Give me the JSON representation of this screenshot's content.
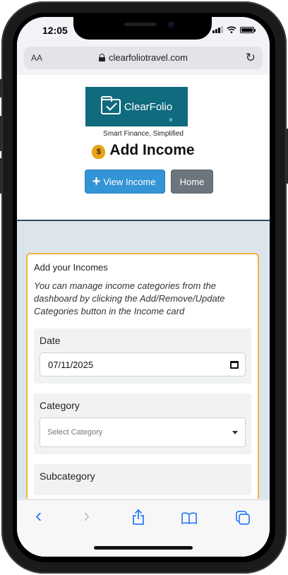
{
  "status": {
    "time": "12:05"
  },
  "browser": {
    "aa_label": "AA",
    "url": "clearfoliotravel.com",
    "reload_icon": "reload-icon"
  },
  "header": {
    "logo_text": "ClearFolio",
    "logo_reg": "®",
    "tagline": "Smart Finance, Simplified",
    "title": "Add Income",
    "title_icon": "money-bag-icon",
    "view_income_label": "View Income",
    "home_label": "Home"
  },
  "form": {
    "card_title": "Add your Incomes",
    "description": "You can manage income categories from the dashboard by clicking the Add/Remove/Update Categories button in the Income card",
    "date_label": "Date",
    "date_value": "07/11/2025",
    "category_label": "Category",
    "category_placeholder": "Select Category",
    "subcategory_label": "Subcategory"
  },
  "toolbar": {
    "back": "‹",
    "forward": "›",
    "share": "share-icon",
    "bookmarks": "bookmarks-icon",
    "tabs": "tabs-icon"
  },
  "colors": {
    "logo_bg": "#0f6b7d",
    "primary_button": "#3394d6",
    "secondary_button": "#6c757d",
    "card_border": "#f3b33d",
    "band_bg": "#dde5ec",
    "ios_accent": "#2f7cf6"
  }
}
